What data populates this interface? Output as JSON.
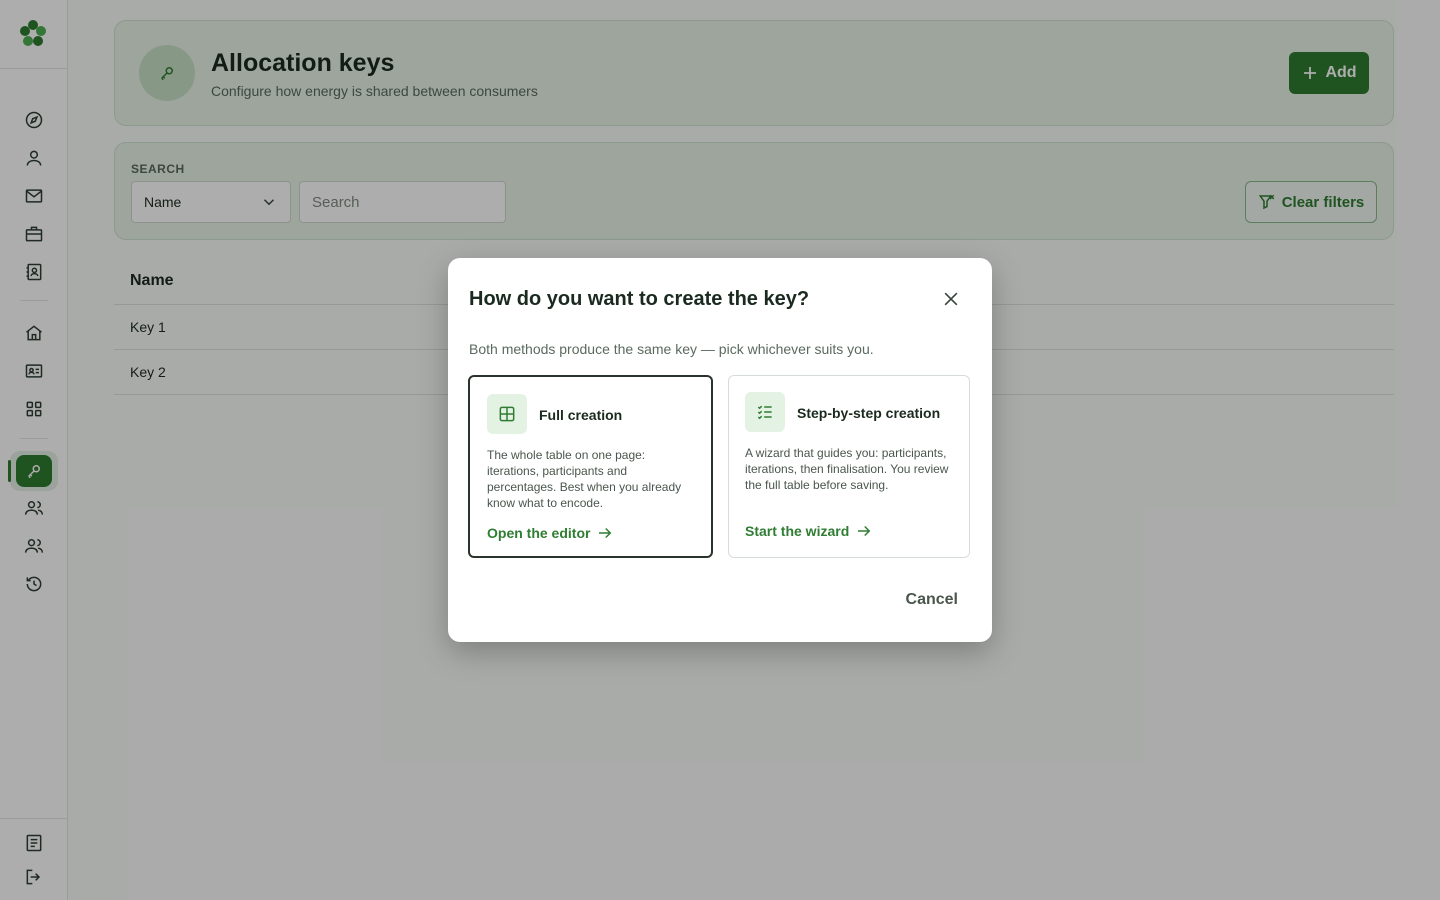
{
  "sidebar": {
    "nav_icons": [
      "compass-icon",
      "user-icon",
      "mail-icon",
      "briefcase-icon",
      "contact-book-icon",
      "home-icon",
      "id-card-icon",
      "grid-icon",
      "key-icon",
      "users-icon",
      "group-icon",
      "history-icon"
    ],
    "bottom_icons": [
      "document-icon",
      "logout-icon"
    ],
    "accent": "#2f7d32"
  },
  "header": {
    "title": "Allocation keys",
    "subtitle": "Configure how energy is shared between consumers",
    "add_label": "Add"
  },
  "search": {
    "label": "SEARCH",
    "field_select": "Name",
    "placeholder": "Search",
    "clear_label": "Clear filters"
  },
  "table": {
    "columns": [
      "Name"
    ],
    "rows": [
      "Key 1",
      "Key 2"
    ]
  },
  "dialog": {
    "title": "How do you want to create the key?",
    "description": "Both methods produce the same key — pick whichever suits you.",
    "options": [
      {
        "title": "Full creation",
        "text": "The whole table on one page: iterations, participants and percentages. Best when you already know what to encode.",
        "link": "Open the editor",
        "icon": "table-icon"
      },
      {
        "title": "Step-by-step creation",
        "text": "A wizard that guides you: participants, iterations, then finalisation. You review the full table before saving.",
        "link": "Start the wizard",
        "icon": "checklist-icon"
      }
    ],
    "cancel_label": "Cancel"
  }
}
